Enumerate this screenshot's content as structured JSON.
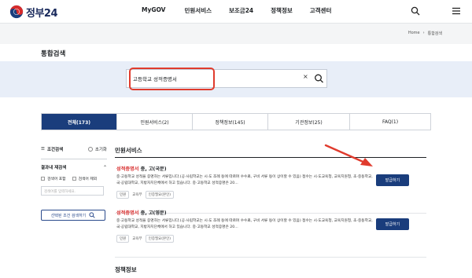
{
  "header": {
    "logo_text": "정부24",
    "nav": [
      "MyGOV",
      "민원서비스",
      "보조금24",
      "정책정보",
      "고객센터"
    ]
  },
  "breadcrumb": [
    "Home",
    "통합검색"
  ],
  "page_title": "통합검색",
  "search": {
    "value": "고등학교 성적증명서",
    "clear": "×"
  },
  "tabs": [
    {
      "label": "전체(173)",
      "active": true
    },
    {
      "label": "민원서비스(2)",
      "active": false
    },
    {
      "label": "정책정보(145)",
      "active": false
    },
    {
      "label": "기관정보(25)",
      "active": false
    },
    {
      "label": "FAQ(1)",
      "active": false
    }
  ],
  "sidebar": {
    "filter_label": "조건검색",
    "reset_label": "초기화",
    "within_label": "결과내 재검색",
    "include_label": "검색어 포함",
    "exclude_label": "검색어 제외",
    "input_placeholder": "검색어를 입력하세요.",
    "apply_label": "선택된 조건 검색하기"
  },
  "sections": {
    "civil": "민원서비스",
    "policy": "정책정보"
  },
  "results": [
    {
      "title_highlight": "성적증명서",
      "title_rest": " 중, 고(국문)",
      "desc": "중·고등학교 성적을 증명하는 서류입니다.(공·사립학교는 시·도 조례 등에 따르며 수수료, 구비 서류 등이 상이할 수 있음) 접수는 시·도교육청, 교육지원청, 초·중등학교, 국·공립대학교, 지방자치단체에서 하고 있습니다. 중·고등학교 성적증명은 20...",
      "tags": [
        "민원",
        "교육부",
        "인증필요(본인)"
      ],
      "button": "발급하기"
    },
    {
      "title_highlight": "성적증명서",
      "title_rest": " 중, 고(영문)",
      "desc": "중·고등학교 성적을 증명하는 서류입니다.(공·사립학교는 시·도 조례 등에 따르며 수수료, 구비 서류 등이 상이할 수 있음) 접수는 시·도교육청, 교육지원청, 초·중등학교, 국·공립대학교, 지방자치단체에서 하고 있습니다. 중·고등학교 성적증명은 20...",
      "tags": [
        "민원",
        "교육부",
        "인증필요(본인)"
      ],
      "button": "발급하기"
    }
  ],
  "colors": {
    "brand": "#1a3d7c",
    "highlight": "#d72b2b",
    "annotation": "#e03b2d"
  }
}
